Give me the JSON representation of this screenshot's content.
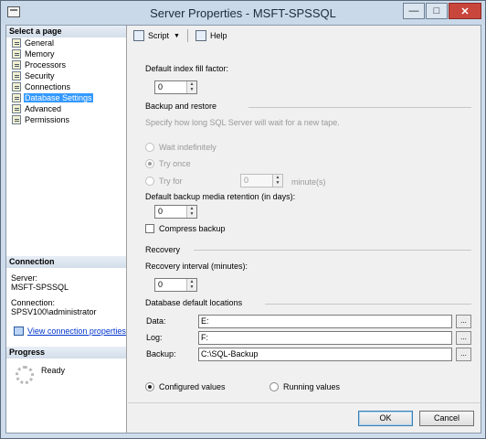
{
  "window": {
    "title": "Server Properties - MSFT-SPSSQL",
    "minimize": "—",
    "maximize": "□",
    "close": "✕"
  },
  "left": {
    "select_page_header": "Select a page",
    "pages": [
      {
        "label": "General",
        "selected": false
      },
      {
        "label": "Memory",
        "selected": false
      },
      {
        "label": "Processors",
        "selected": false
      },
      {
        "label": "Security",
        "selected": false
      },
      {
        "label": "Connections",
        "selected": false
      },
      {
        "label": "Database Settings",
        "selected": true
      },
      {
        "label": "Advanced",
        "selected": false
      },
      {
        "label": "Permissions",
        "selected": false
      }
    ],
    "connection_header": "Connection",
    "server_label": "Server:",
    "server_value": "MSFT-SPSSQL",
    "connection_label": "Connection:",
    "connection_value": "SPSV100\\administrator",
    "view_connection_link": "View connection properties",
    "progress_header": "Progress",
    "progress_status": "Ready"
  },
  "toolbar": {
    "script_label": "Script",
    "help_label": "Help"
  },
  "settings": {
    "fill_factor_label": "Default index fill factor:",
    "fill_factor_value": "0",
    "backup_restore_heading": "Backup and restore",
    "tape_wait_hint": "Specify how long SQL Server will wait for a new tape.",
    "wait_indefinitely": "Wait indefinitely",
    "try_once": "Try once",
    "try_for": "Try for",
    "try_for_value": "0",
    "minutes_unit": "minute(s)",
    "retention_label": "Default backup media retention (in days):",
    "retention_value": "0",
    "compress_backup": "Compress backup",
    "recovery_heading": "Recovery",
    "recovery_interval_label": "Recovery interval (minutes):",
    "recovery_interval_value": "0",
    "default_locations_heading": "Database default locations",
    "data_label": "Data:",
    "data_value": "E:",
    "log_label": "Log:",
    "log_value": "F:",
    "backup_label": "Backup:",
    "backup_value": "C:\\SQL-Backup",
    "browse_label": "...",
    "configured_values": "Configured values",
    "running_values": "Running values"
  },
  "buttons": {
    "ok": "OK",
    "cancel": "Cancel"
  }
}
